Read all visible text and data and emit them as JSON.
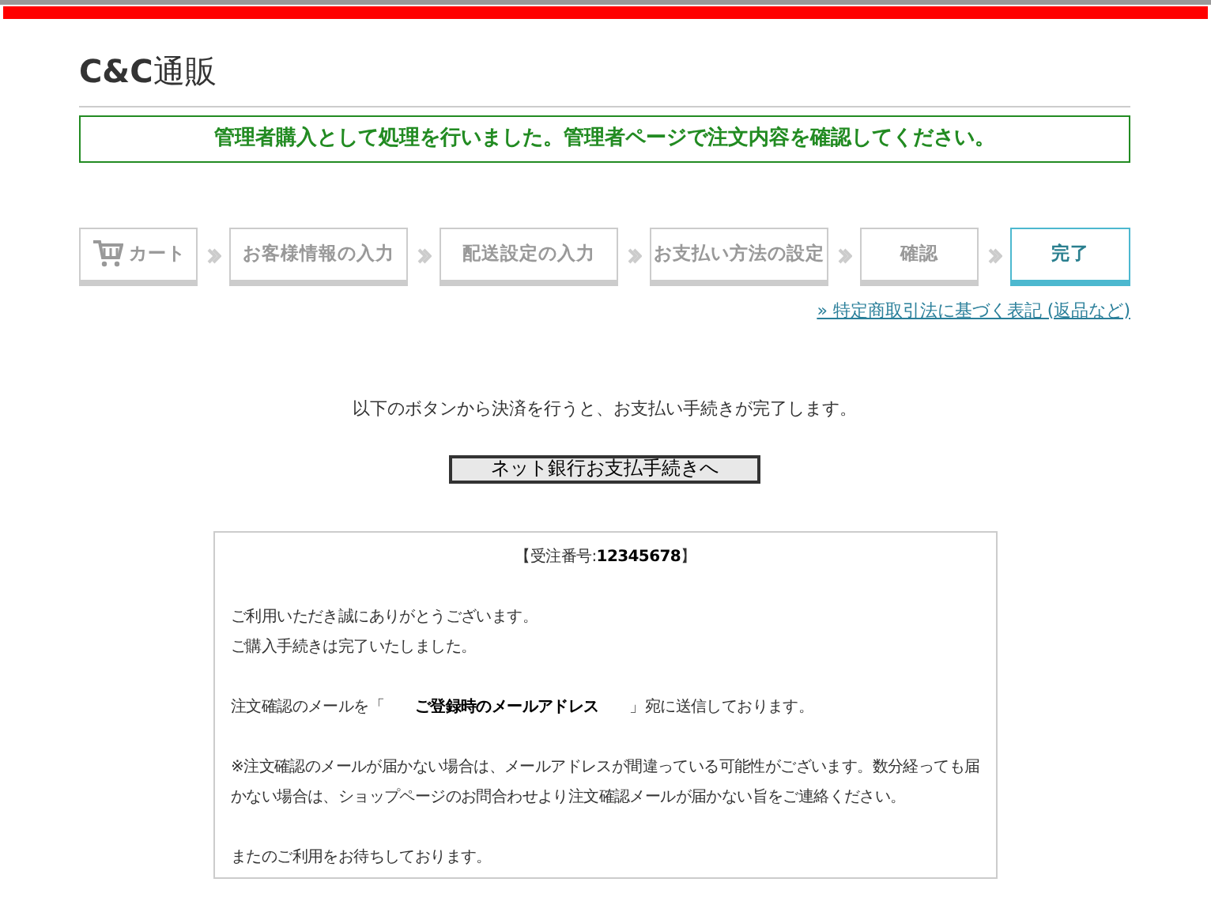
{
  "logo": {
    "brand": "C&C",
    "suffix": "通販"
  },
  "notice": "管理者購入として処理を行いました。管理者ページで注文内容を確認してください。",
  "steps": [
    {
      "label": "カート",
      "kind": "cart",
      "selected": false
    },
    {
      "label": "お客様情報の入力",
      "selected": false
    },
    {
      "label": "配送設定の入力",
      "selected": false
    },
    {
      "label": "お支払い方法の設定",
      "selected": false
    },
    {
      "label": "確認",
      "selected": false
    },
    {
      "label": "完了",
      "selected": true
    }
  ],
  "legal_link": "» 特定商取引法に基づく表記 (返品など)",
  "instruction": "以下のボタンから決済を行うと、お支払い手続きが完了します。",
  "pay_button": "ネット銀行お支払手続きへ",
  "message": {
    "order_number": "【受注番号:**12345678**】",
    "paragraphs": [
      [
        "ご利用いただき誠にありがとうございます。",
        "ご購入手続きは完了いたしました。"
      ],
      [
        "注文確認のメールを「　　**ご登録時のメールアドレス**　　」宛に送信しております。"
      ],
      [
        "※注文確認のメールが届かない場合は、メールアドレスが間違っている可能性がございます。数分経っても届かない場合は、ショップページのお問合わせより注文確認メールが届かない旨をご連絡ください。"
      ],
      [
        "またのご利用をお待ちしております。"
      ]
    ]
  }
}
